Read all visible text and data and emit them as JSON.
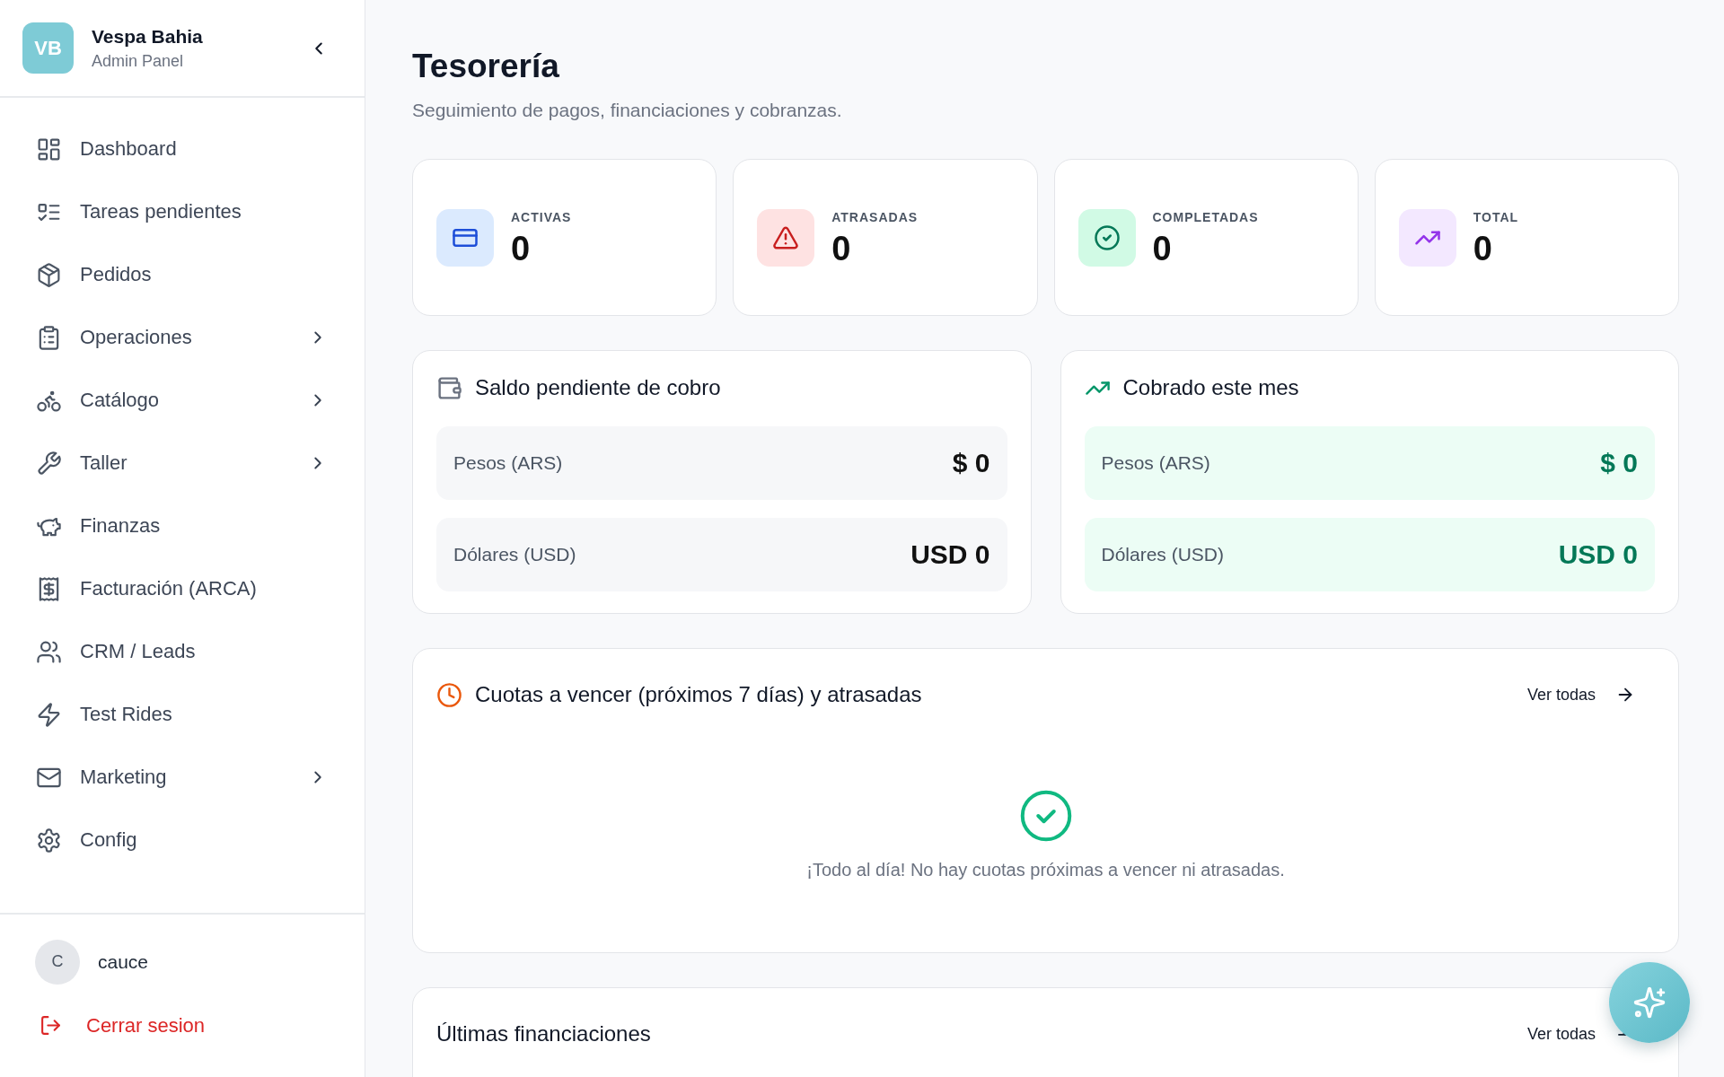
{
  "sidebar": {
    "brand": {
      "initials": "VB",
      "name": "Vespa Bahia",
      "subtitle": "Admin Panel"
    },
    "items": [
      {
        "label": "Dashboard",
        "expandable": false
      },
      {
        "label": "Tareas pendientes",
        "expandable": false
      },
      {
        "label": "Pedidos",
        "expandable": false
      },
      {
        "label": "Operaciones",
        "expandable": true
      },
      {
        "label": "Catálogo",
        "expandable": true
      },
      {
        "label": "Taller",
        "expandable": true
      },
      {
        "label": "Finanzas",
        "expandable": false
      },
      {
        "label": "Facturación (ARCA)",
        "expandable": false
      },
      {
        "label": "CRM / Leads",
        "expandable": false
      },
      {
        "label": "Test Rides",
        "expandable": false
      },
      {
        "label": "Marketing",
        "expandable": true
      },
      {
        "label": "Config",
        "expandable": false
      }
    ],
    "user": {
      "initial": "C",
      "name": "cauce"
    },
    "logout": {
      "label": "Cerrar sesion"
    }
  },
  "header": {
    "title": "Tesorería",
    "subtitle": "Seguimiento de pagos, financiaciones y cobranzas."
  },
  "stats": [
    {
      "label": "ACTIVAS",
      "value": "0"
    },
    {
      "label": "ATRASADAS",
      "value": "0"
    },
    {
      "label": "COMPLETADAS",
      "value": "0"
    },
    {
      "label": "TOTAL",
      "value": "0"
    }
  ],
  "balances": [
    {
      "title": "Saldo pendiente de cobro",
      "kind": "pending",
      "rows": [
        {
          "label": "Pesos (ARS)",
          "value": "$ 0"
        },
        {
          "label": "Dólares (USD)",
          "value": "USD 0"
        }
      ]
    },
    {
      "title": "Cobrado este mes",
      "kind": "collected",
      "rows": [
        {
          "label": "Pesos (ARS)",
          "value": "$ 0"
        },
        {
          "label": "Dólares (USD)",
          "value": "USD 0"
        }
      ]
    }
  ],
  "installments": {
    "title": "Cuotas a vencer (próximos 7 días) y atrasadas",
    "link": "Ver todas",
    "empty_message": "¡Todo al día! No hay cuotas próximas a vencer ni atrasadas."
  },
  "latest_financings": {
    "title": "Últimas financiaciones",
    "link": "Ver todas"
  }
}
